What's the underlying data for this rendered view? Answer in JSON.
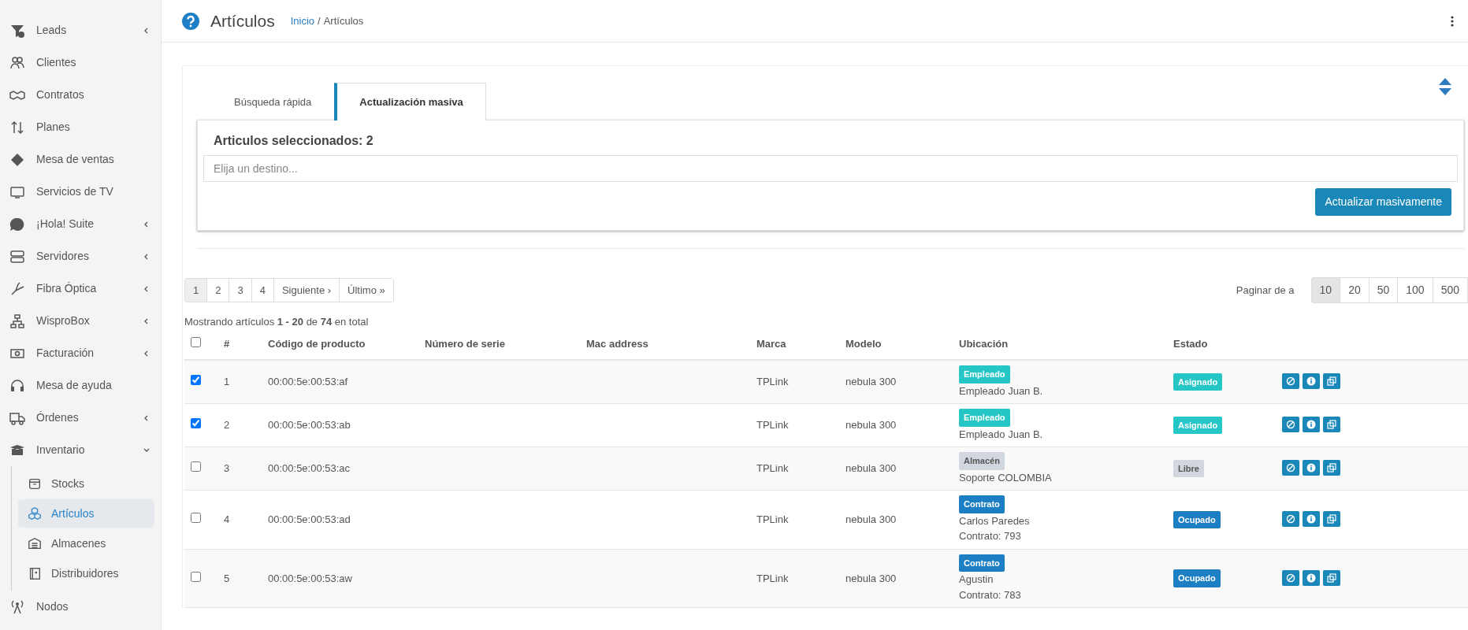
{
  "sidebar": {
    "items": [
      {
        "label": "Leads",
        "kind": "group",
        "expanded": false
      },
      {
        "label": "Clientes",
        "kind": "link"
      },
      {
        "label": "Contratos",
        "kind": "link"
      },
      {
        "label": "Planes",
        "kind": "link"
      },
      {
        "label": "Mesa de ventas",
        "kind": "link"
      },
      {
        "label": "Servicios de TV",
        "kind": "link"
      },
      {
        "label": "¡Hola! Suite",
        "kind": "group",
        "expanded": false
      },
      {
        "label": "Servidores",
        "kind": "group",
        "expanded": false
      },
      {
        "label": "Fibra Óptica",
        "kind": "group",
        "expanded": false
      },
      {
        "label": "WisproBox",
        "kind": "group",
        "expanded": false
      },
      {
        "label": "Facturación",
        "kind": "group",
        "expanded": false
      },
      {
        "label": "Mesa de ayuda",
        "kind": "link"
      },
      {
        "label": "Órdenes",
        "kind": "group",
        "expanded": false
      },
      {
        "label": "Inventario",
        "kind": "group",
        "expanded": true,
        "children": [
          {
            "label": "Stocks",
            "selected": false
          },
          {
            "label": "Artículos",
            "selected": true
          },
          {
            "label": "Almacenes",
            "selected": false
          },
          {
            "label": "Distribuidores",
            "selected": false
          }
        ]
      },
      {
        "label": "Nodos",
        "kind": "link"
      }
    ]
  },
  "header": {
    "title": "Artículos",
    "breadcrumb_separator": "/",
    "breadcrumb": [
      {
        "label": "Inicio",
        "kind": "link"
      },
      {
        "label": "Artículos",
        "kind": "current"
      }
    ]
  },
  "tabs": [
    {
      "label": "Búsqueda rápida",
      "selected": false
    },
    {
      "label": "Actualización masiva",
      "selected": true
    }
  ],
  "mass_update": {
    "title": "Articulos seleccionados: 2",
    "destination_field": {
      "placeholder": "Elija un destino..."
    },
    "button": "Actualizar masivamente"
  },
  "pagination": {
    "pages": [
      {
        "label": "1",
        "selected": true
      },
      {
        "label": "2",
        "selected": false
      },
      {
        "label": "3",
        "selected": false
      },
      {
        "label": "4",
        "selected": false
      },
      {
        "label": "Siguiente ›",
        "selected": false
      },
      {
        "label": "Último »",
        "selected": false
      }
    ]
  },
  "per_page": {
    "label": "Paginar de a",
    "options": [
      {
        "label": "10",
        "selected": true
      },
      {
        "label": "20",
        "selected": false
      },
      {
        "label": "50",
        "selected": false
      },
      {
        "label": "100",
        "selected": false
      },
      {
        "label": "500",
        "selected": false
      }
    ]
  },
  "summary": "Mostrando artículos **1 - 20** de **74** en total",
  "table": {
    "select_all": {
      "checked": false
    },
    "columns": [
      "#",
      "Código de producto",
      "Número de serie",
      "Mac address",
      "Marca",
      "Modelo",
      "Ubicación",
      "Estado"
    ],
    "rows": [
      {
        "checked": true,
        "number": "1",
        "code": "00:00:5e:00:53:af",
        "brand": "TPLink",
        "model": "nebula 300",
        "location": {
          "tag": {
            "label": "Empleado",
            "color": "#26c6c6"
          },
          "lines": [
            "Empleado Juan B."
          ]
        },
        "status": {
          "label": "Asignado",
          "color": "#26c6c6"
        }
      },
      {
        "checked": true,
        "number": "2",
        "code": "00:00:5e:00:53:ab",
        "brand": "TPLink",
        "model": "nebula 300",
        "location": {
          "tag": {
            "label": "Empleado",
            "color": "#26c6c6"
          },
          "lines": [
            "Empleado Juan B."
          ]
        },
        "status": {
          "label": "Asignado",
          "color": "#26c6c6"
        }
      },
      {
        "checked": false,
        "number": "3",
        "code": "00:00:5e:00:53:ac",
        "brand": "TPLink",
        "model": "nebula 300",
        "location": {
          "tag": {
            "label": "Almacén",
            "color": "#d2d6de"
          },
          "lines": [
            "Soporte COLOMBIA"
          ]
        },
        "status": {
          "label": "Libre",
          "color": "#d2d6de"
        }
      },
      {
        "checked": false,
        "number": "4",
        "code": "00:00:5e:00:53:ad",
        "brand": "TPLink",
        "model": "nebula 300",
        "location": {
          "tag": {
            "label": "Contrato",
            "color": "#1c7fc4"
          },
          "lines": [
            "Carlos Paredes",
            "Contrato: 793"
          ]
        },
        "status": {
          "label": "Ocupado",
          "color": "#1c7fc4"
        }
      },
      {
        "checked": false,
        "number": "5",
        "code": "00:00:5e:00:53:aw",
        "brand": "TPLink",
        "model": "nebula 300",
        "location": {
          "tag": {
            "label": "Contrato",
            "color": "#1c7fc4"
          },
          "lines": [
            "Agustin",
            "Contrato: 783"
          ]
        },
        "status": {
          "label": "Ocupado",
          "color": "#1c7fc4"
        }
      }
    ]
  }
}
